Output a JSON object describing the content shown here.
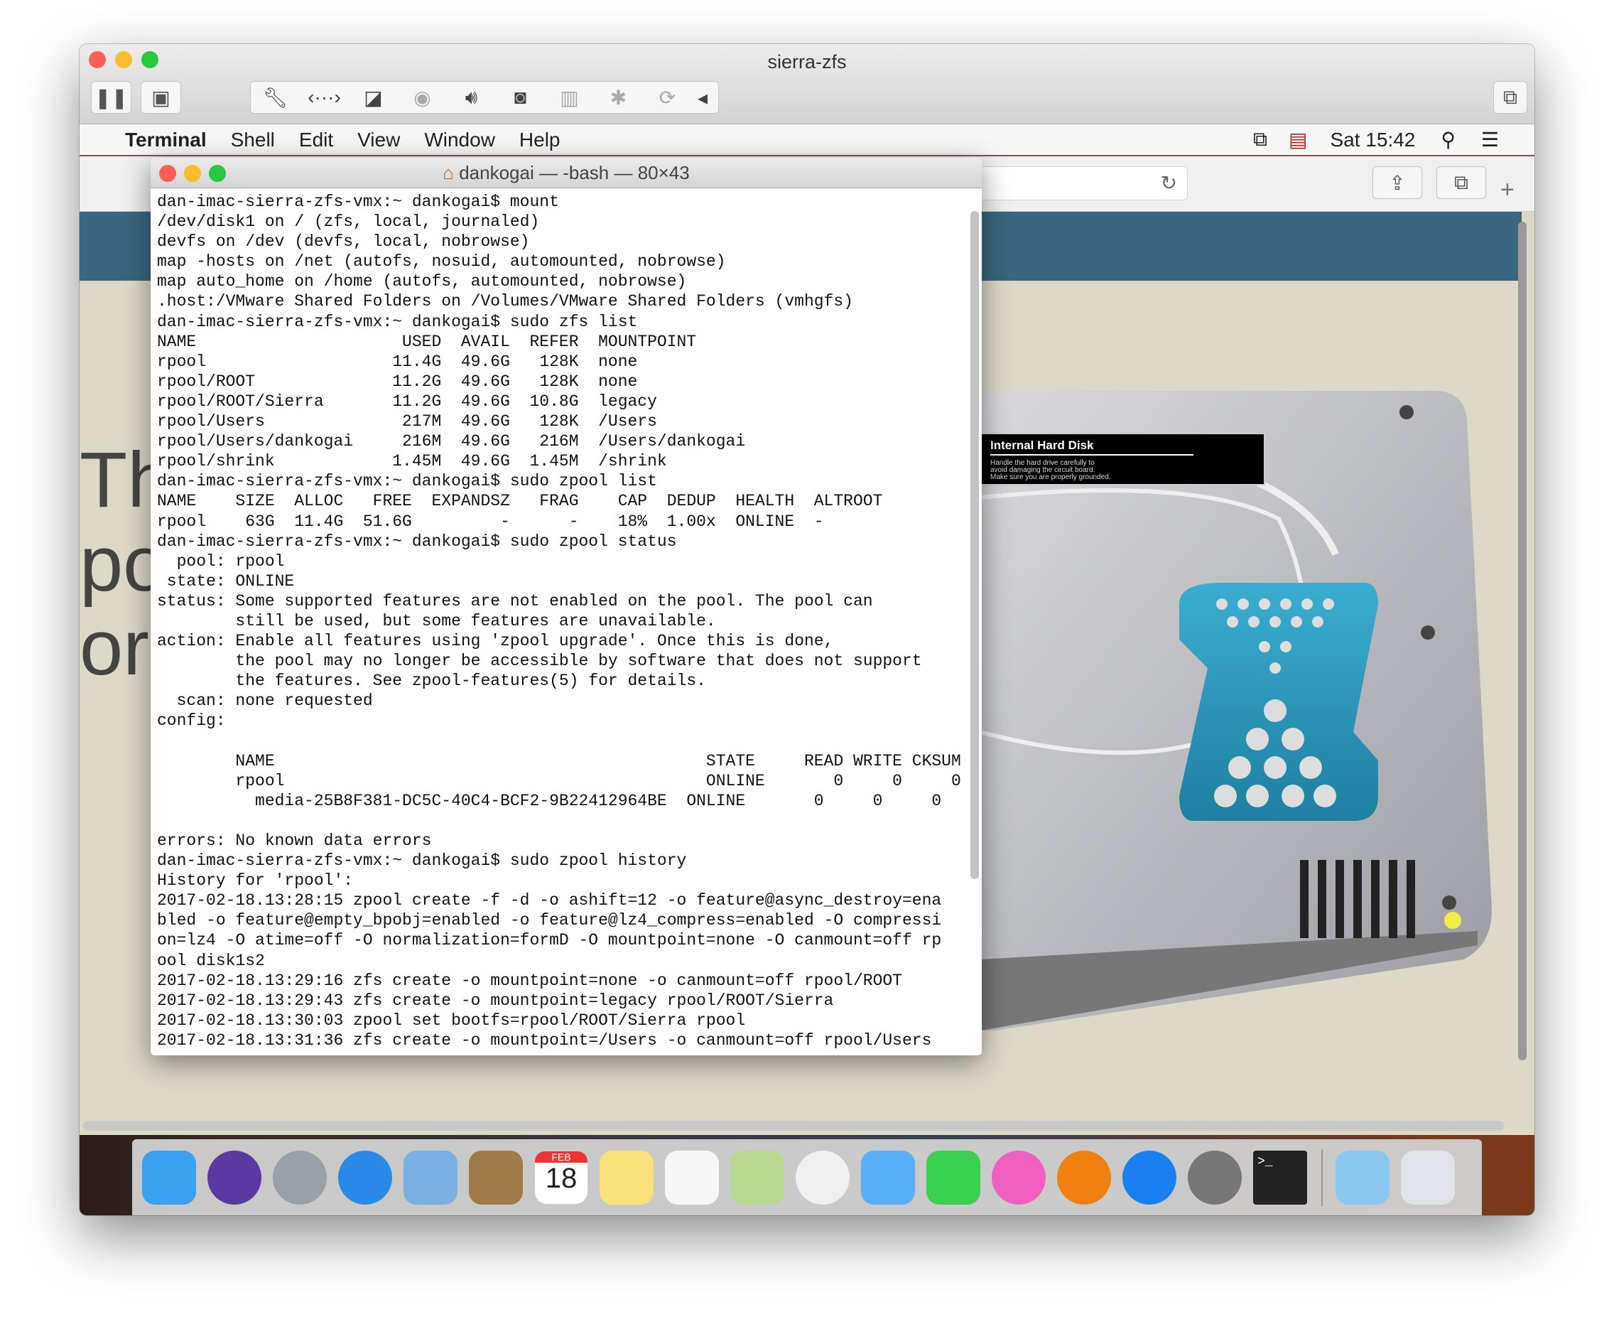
{
  "vm_window": {
    "title": "sierra-zfs",
    "toolbar_icons": [
      "pause-icon",
      "snapshot-icon",
      "wrench-icon",
      "network-icon",
      "hard-disk-icon",
      "cd-icon",
      "sound-icon",
      "camera-icon",
      "usb-icon",
      "bluetooth-icon",
      "sync-icon",
      "chevron-left-icon",
      "fullscreen-icon"
    ]
  },
  "menubar": {
    "app": "Terminal",
    "items": [
      "Shell",
      "Edit",
      "View",
      "Window",
      "Help"
    ],
    "clock": "Sat 15:42"
  },
  "background_page": {
    "heading_fragment": [
      "Th",
      "po",
      "or"
    ],
    "disk_label": {
      "title": "Internal Hard Disk",
      "text": [
        "Handle the hard drive carefully to",
        "avoid damaging the circuit board.",
        "Make sure you are properly grounded."
      ]
    }
  },
  "terminal": {
    "title": "dankogai — -bash — 80×43",
    "lines": [
      "dan-imac-sierra-zfs-vmx:~ dankogai$ mount",
      "/dev/disk1 on / (zfs, local, journaled)",
      "devfs on /dev (devfs, local, nobrowse)",
      "map -hosts on /net (autofs, nosuid, automounted, nobrowse)",
      "map auto_home on /home (autofs, automounted, nobrowse)",
      ".host:/VMware Shared Folders on /Volumes/VMware Shared Folders (vmhgfs)",
      "dan-imac-sierra-zfs-vmx:~ dankogai$ sudo zfs list",
      "NAME                     USED  AVAIL  REFER  MOUNTPOINT",
      "rpool                   11.4G  49.6G   128K  none",
      "rpool/ROOT              11.2G  49.6G   128K  none",
      "rpool/ROOT/Sierra       11.2G  49.6G  10.8G  legacy",
      "rpool/Users              217M  49.6G   128K  /Users",
      "rpool/Users/dankogai     216M  49.6G   216M  /Users/dankogai",
      "rpool/shrink            1.45M  49.6G  1.45M  /shrink",
      "dan-imac-sierra-zfs-vmx:~ dankogai$ sudo zpool list",
      "NAME    SIZE  ALLOC   FREE  EXPANDSZ   FRAG    CAP  DEDUP  HEALTH  ALTROOT",
      "rpool    63G  11.4G  51.6G         -      -    18%  1.00x  ONLINE  -",
      "dan-imac-sierra-zfs-vmx:~ dankogai$ sudo zpool status",
      "  pool: rpool",
      " state: ONLINE",
      "status: Some supported features are not enabled on the pool. The pool can",
      "        still be used, but some features are unavailable.",
      "action: Enable all features using 'zpool upgrade'. Once this is done,",
      "        the pool may no longer be accessible by software that does not support",
      "        the features. See zpool-features(5) for details.",
      "  scan: none requested",
      "config:",
      "",
      "        NAME                                            STATE     READ WRITE CKSUM",
      "        rpool                                           ONLINE       0     0     0",
      "          media-25B8F381-DC5C-40C4-BCF2-9B22412964BE  ONLINE       0     0     0",
      "",
      "errors: No known data errors",
      "dan-imac-sierra-zfs-vmx:~ dankogai$ sudo zpool history",
      "History for 'rpool':",
      "2017-02-18.13:28:15 zpool create -f -d -o ashift=12 -o feature@async_destroy=ena",
      "bled -o feature@empty_bpobj=enabled -o feature@lz4_compress=enabled -O compressi",
      "on=lz4 -O atime=off -O normalization=formD -O mountpoint=none -O canmount=off rp",
      "ool disk1s2",
      "2017-02-18.13:29:16 zfs create -o mountpoint=none -o canmount=off rpool/ROOT",
      "2017-02-18.13:29:43 zfs create -o mountpoint=legacy rpool/ROOT/Sierra",
      "2017-02-18.13:30:03 zpool set bootfs=rpool/ROOT/Sierra rpool",
      "2017-02-18.13:31:36 zfs create -o mountpoint=/Users -o canmount=off rpool/Users"
    ]
  },
  "dock": {
    "calendar": {
      "month": "FEB",
      "day": "18"
    },
    "apps": [
      {
        "name": "finder",
        "color": "#3aa0f0",
        "running": true
      },
      {
        "name": "siri",
        "color": "#5a3aa0"
      },
      {
        "name": "launchpad",
        "color": "#9aa0a8"
      },
      {
        "name": "safari",
        "color": "#2a8ae8",
        "running": true
      },
      {
        "name": "mail",
        "color": "#7ab0e0"
      },
      {
        "name": "contacts",
        "color": "#a07a48"
      },
      {
        "name": "calendar",
        "color": "#ffffff"
      },
      {
        "name": "notes",
        "color": "#f7e27a"
      },
      {
        "name": "reminders",
        "color": "#f7f7f7"
      },
      {
        "name": "maps",
        "color": "#b8d890"
      },
      {
        "name": "photos",
        "color": "#f0f0f0"
      },
      {
        "name": "messages",
        "color": "#5ab0f8"
      },
      {
        "name": "facetime",
        "color": "#3ad050"
      },
      {
        "name": "itunes",
        "color": "#f060c0"
      },
      {
        "name": "ibooks",
        "color": "#f08010"
      },
      {
        "name": "app-store",
        "color": "#1a80f0"
      },
      {
        "name": "system-preferences",
        "color": "#777777"
      },
      {
        "name": "terminal",
        "color": "#222222",
        "running": true
      }
    ],
    "right": [
      {
        "name": "downloads",
        "color": "#8ac8f0"
      },
      {
        "name": "trash",
        "color": "#e0e4e8"
      }
    ]
  }
}
